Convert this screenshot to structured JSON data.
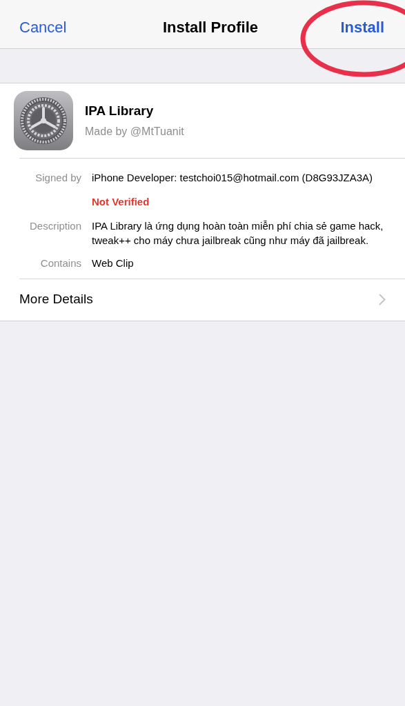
{
  "nav": {
    "cancel": "Cancel",
    "title": "Install Profile",
    "install": "Install",
    "install_highlighted": true
  },
  "profile": {
    "name": "IPA Library",
    "author": "Made by @MtTuanit"
  },
  "fields": [
    {
      "label": "Signed by",
      "value": "iPhone Developer: testchoi015@hotmail.com (D8G93JZA3A)",
      "verification": {
        "text": "Not Verified",
        "verified": false
      }
    },
    {
      "label": "Description",
      "value": "IPA Library là ứng dụng hoàn toàn miễn phí chia sẻ game hack, tweak++ cho máy chưa jailbreak cũng như máy đã jailbreak."
    },
    {
      "label": "Contains",
      "value": "Web Clip"
    }
  ],
  "more_details": "More Details"
}
